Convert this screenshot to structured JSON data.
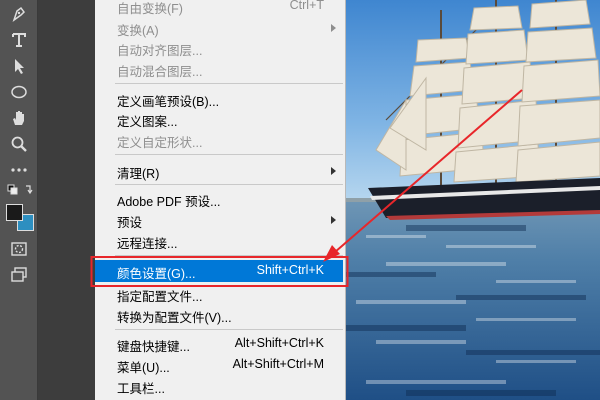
{
  "menu": {
    "items": [
      {
        "label": "自由变换(F)",
        "shortcut": "Ctrl+T",
        "disabled": true,
        "submenu": false
      },
      {
        "label": "变换(A)",
        "shortcut": "",
        "disabled": true,
        "submenu": true
      },
      {
        "label": "自动对齐图层...",
        "shortcut": "",
        "disabled": true,
        "submenu": false
      },
      {
        "label": "自动混合图层...",
        "shortcut": "",
        "disabled": true,
        "submenu": false
      },
      {
        "label": "定义画笔预设(B)...",
        "shortcut": "",
        "disabled": false,
        "submenu": false
      },
      {
        "label": "定义图案...",
        "shortcut": "",
        "disabled": false,
        "submenu": false
      },
      {
        "label": "定义自定形状...",
        "shortcut": "",
        "disabled": true,
        "submenu": false
      },
      {
        "label": "清理(R)",
        "shortcut": "",
        "disabled": false,
        "submenu": true
      },
      {
        "label": "Adobe PDF 预设...",
        "shortcut": "",
        "disabled": false,
        "submenu": false
      },
      {
        "label": "预设",
        "shortcut": "",
        "disabled": false,
        "submenu": true
      },
      {
        "label": "远程连接...",
        "shortcut": "",
        "disabled": false,
        "submenu": false
      },
      {
        "label": "颜色设置(G)...",
        "shortcut": "Shift+Ctrl+K",
        "disabled": false,
        "submenu": false,
        "highlighted": true
      },
      {
        "label": "指定配置文件...",
        "shortcut": "",
        "disabled": false,
        "submenu": false
      },
      {
        "label": "转换为配置文件(V)...",
        "shortcut": "",
        "disabled": false,
        "submenu": false
      },
      {
        "label": "键盘快捷键...",
        "shortcut": "Alt+Shift+Ctrl+K",
        "disabled": false,
        "submenu": false
      },
      {
        "label": "菜单(U)...",
        "shortcut": "Alt+Shift+Ctrl+M",
        "disabled": false,
        "submenu": false
      },
      {
        "label": "工具栏...",
        "shortcut": "",
        "disabled": false,
        "submenu": false
      }
    ]
  },
  "toolbar": {
    "tools": [
      "pen-icon",
      "type-icon",
      "path-selection-icon",
      "ellipse-icon",
      "hand-icon",
      "zoom-icon",
      "more-tools-icon",
      "default-colors-icon",
      "color-swatches",
      "quick-mask-icon",
      "screen-mode-icon"
    ],
    "foreground_color": "#1a1a1a",
    "background_color": "#2d8fc0"
  },
  "colors": {
    "highlight": "#0078d7",
    "annotation": "#e8262a",
    "menu_bg": "#f0f0f0"
  }
}
